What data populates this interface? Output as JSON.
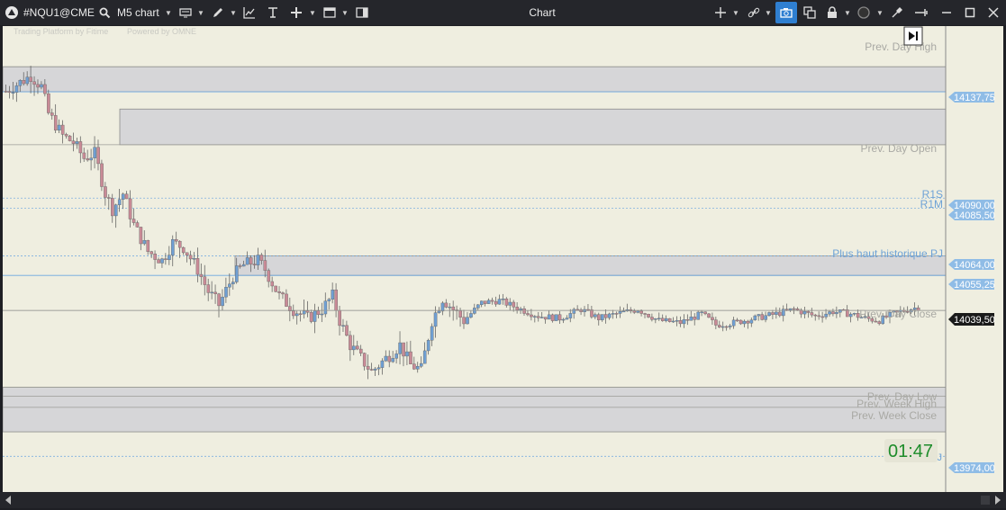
{
  "toolbar": {
    "symbol": "#NQU1@CME",
    "timeframe": "M5 chart",
    "window_title": "Chart"
  },
  "chart": {
    "watermark_left": "Trading Platform by Fitime",
    "watermark_right": "Powered by OMNE",
    "timer": "01:47",
    "timer_color": "#1d8c2a",
    "up_color": "#6f9fd3",
    "down_color": "#c98a96",
    "price_line_color": "#6ba7e0",
    "zone_color": "#d6d6d8",
    "level_labels": {
      "prev_day_high": "Prev. Day High",
      "prev_day_open": "Prev. Day Open",
      "r1s": "R1S",
      "r1m": "R1M",
      "plus_haut": "Plus haut historique PJ",
      "prev_day_close": "Prev. Day Close",
      "prev_day_low": "Prev. Day Low",
      "prev_week_high": "Prev. Week High",
      "prev_week_close": "Prev. Week Close",
      "j": "J"
    },
    "price_tags": {
      "p14137": "14137,75",
      "p14090": "14090,00",
      "p14085": "14085,50",
      "p14064": "14064,00",
      "p14055": "14055,25",
      "p14039": "14039,50",
      "p13974": "13974,00"
    }
  },
  "chart_data": {
    "type": "candlestick",
    "symbol": "#NQU1@CME",
    "interval": "M5",
    "y_range": [
      13962,
      14160
    ],
    "current_price": 14039.5,
    "levels": [
      {
        "label": "Prev. Day High",
        "price": 14149
      },
      {
        "label": "Prev. Day Open",
        "price": 14114
      },
      {
        "label": "R1S",
        "price": 14090.0
      },
      {
        "label": "R1M",
        "price": 14085.5
      },
      {
        "label": "Plus haut historique PJ",
        "price": 14064.0
      },
      {
        "label": "Prev. Day Close",
        "price": 14039.5
      },
      {
        "label": "Prev. Day Low",
        "price": 14005
      },
      {
        "label": "Prev. Week High",
        "price": 14001
      },
      {
        "label": "Prev. Week Close",
        "price": 13996
      },
      {
        "label": "J",
        "price": 13974.0
      }
    ],
    "zones": [
      {
        "from": 14137.75,
        "to": 14149
      },
      {
        "from": 14114,
        "to": 14130
      },
      {
        "from": 14055.25,
        "to": 14064.0
      },
      {
        "from": 13985,
        "to": 14005
      }
    ],
    "close_path": [
      [
        0,
        14138
      ],
      [
        8,
        14142
      ],
      [
        14,
        14145
      ],
      [
        20,
        14140
      ],
      [
        24,
        14128
      ],
      [
        32,
        14118
      ],
      [
        38,
        14115
      ],
      [
        44,
        14108
      ],
      [
        50,
        14110
      ],
      [
        56,
        14092
      ],
      [
        60,
        14085
      ],
      [
        66,
        14092
      ],
      [
        72,
        14078
      ],
      [
        80,
        14066
      ],
      [
        88,
        14062
      ],
      [
        94,
        14070
      ],
      [
        100,
        14068
      ],
      [
        108,
        14058
      ],
      [
        114,
        14048
      ],
      [
        120,
        14042
      ],
      [
        128,
        14055
      ],
      [
        134,
        14060
      ],
      [
        142,
        14062
      ],
      [
        146,
        14058
      ],
      [
        154,
        14046
      ],
      [
        162,
        14040
      ],
      [
        170,
        14036
      ],
      [
        178,
        14040
      ],
      [
        184,
        14046
      ],
      [
        188,
        14035
      ],
      [
        194,
        14024
      ],
      [
        200,
        14018
      ],
      [
        206,
        14012
      ],
      [
        214,
        14018
      ],
      [
        222,
        14024
      ],
      [
        228,
        14015
      ],
      [
        234,
        14013
      ],
      [
        240,
        14035
      ],
      [
        246,
        14045
      ],
      [
        252,
        14040
      ],
      [
        258,
        14035
      ],
      [
        268,
        14043
      ],
      [
        278,
        14044
      ],
      [
        290,
        14040
      ],
      [
        300,
        14037
      ],
      [
        312,
        14036
      ],
      [
        324,
        14040
      ],
      [
        334,
        14036
      ],
      [
        344,
        14038
      ],
      [
        356,
        14040
      ],
      [
        368,
        14035
      ],
      [
        380,
        14034
      ],
      [
        392,
        14038
      ],
      [
        400,
        14033
      ],
      [
        410,
        14034
      ],
      [
        422,
        14036
      ],
      [
        434,
        14038
      ],
      [
        444,
        14040
      ],
      [
        456,
        14037
      ],
      [
        466,
        14039
      ],
      [
        476,
        14038
      ],
      [
        484,
        14036
      ],
      [
        492,
        14035
      ],
      [
        500,
        14038
      ],
      [
        508,
        14040
      ],
      [
        514,
        14041
      ]
    ]
  }
}
